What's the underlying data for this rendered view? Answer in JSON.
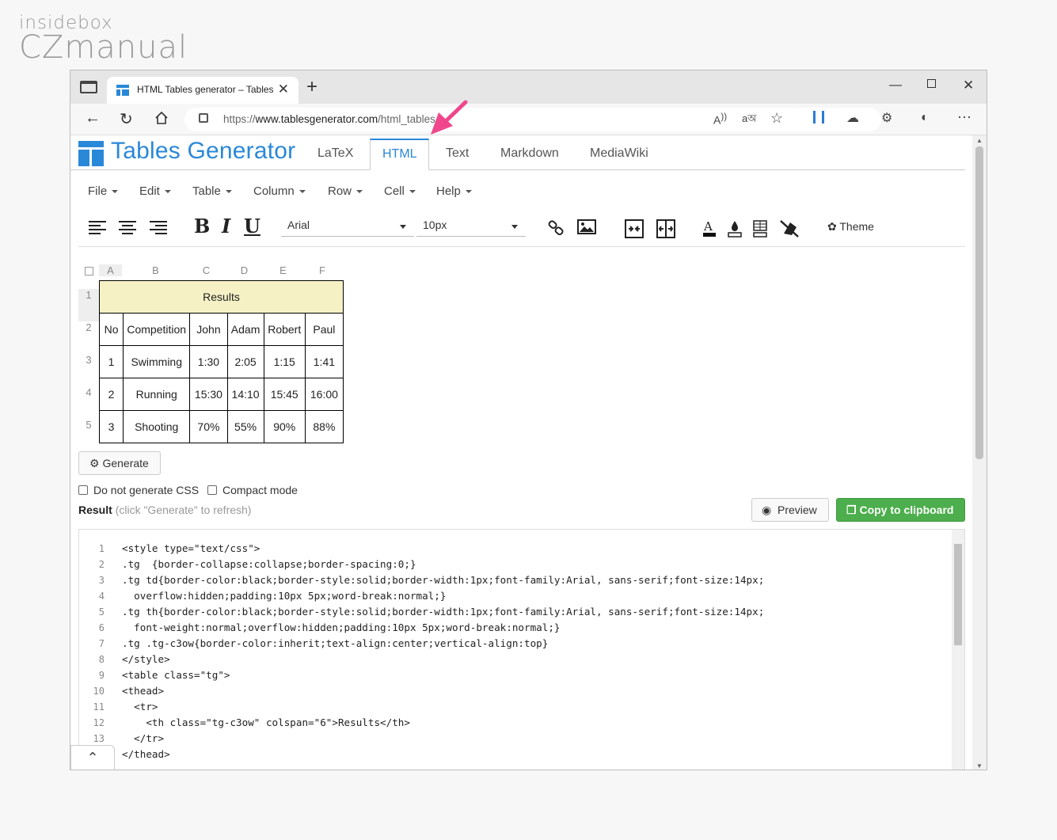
{
  "watermark": {
    "line1": "insidebox",
    "line2": "CZmanual"
  },
  "browser": {
    "tab_title": "HTML Tables generator – TablesGenerator.com",
    "url_prefix": "https://",
    "url_host": "www.tablesgenerator.com",
    "url_path": "/html_tables",
    "new_tab": "+",
    "close_tab": "✕"
  },
  "site": {
    "brand": "Tables Generator",
    "tabs": [
      "LaTeX",
      "HTML",
      "Text",
      "Markdown",
      "MediaWiki"
    ],
    "active_tab": "HTML",
    "menus": [
      "File",
      "Edit",
      "Table",
      "Column",
      "Row",
      "Cell",
      "Help"
    ],
    "font": "Arial",
    "font_size": "10px",
    "theme_label": "Theme"
  },
  "grid": {
    "columns": [
      "A",
      "B",
      "C",
      "D",
      "E",
      "F"
    ],
    "rows": [
      "1",
      "2",
      "3",
      "4",
      "5"
    ],
    "title": "Results",
    "header": [
      "No",
      "Competition",
      "John",
      "Adam",
      "Robert",
      "Paul"
    ],
    "body": [
      [
        "1",
        "Swimming",
        "1:30",
        "2:05",
        "1:15",
        "1:41"
      ],
      [
        "2",
        "Running",
        "15:30",
        "14:10",
        "15:45",
        "16:00"
      ],
      [
        "3",
        "Shooting",
        "70%",
        "55%",
        "90%",
        "88%"
      ]
    ]
  },
  "controls": {
    "generate": "Generate",
    "no_css": "Do not generate CSS",
    "compact": "Compact mode",
    "result_label": "Result",
    "result_hint": "(click \"Generate\" to refresh)",
    "preview": "Preview",
    "copy": "Copy to clipboard"
  },
  "code": {
    "line_numbers": [
      "1",
      "2",
      "3",
      "4",
      "5",
      "6",
      "7",
      "8",
      "9",
      "10",
      "11",
      "12",
      "13"
    ],
    "lines": [
      "<style type=\"text/css\">",
      ".tg  {border-collapse:collapse;border-spacing:0;}",
      ".tg td{border-color:black;border-style:solid;border-width:1px;font-family:Arial, sans-serif;font-size:14px;",
      "  overflow:hidden;padding:10px 5px;word-break:normal;}",
      ".tg th{border-color:black;border-style:solid;border-width:1px;font-family:Arial, sans-serif;font-size:14px;",
      "  font-weight:normal;overflow:hidden;padding:10px 5px;word-break:normal;}",
      ".tg .tg-c3ow{border-color:inherit;text-align:center;vertical-align:top}",
      "</style>",
      "<table class=\"tg\">",
      "<thead>",
      "  <tr>",
      "    <th class=\"tg-c3ow\" colspan=\"6\">Results</th>",
      "  </tr>",
      "</thead>"
    ]
  },
  "colors": {
    "accent": "#2a88d8",
    "copy_green": "#4cae4c",
    "result_yellow": "#f5f1c5",
    "arrow_pink": "#f0468c"
  }
}
